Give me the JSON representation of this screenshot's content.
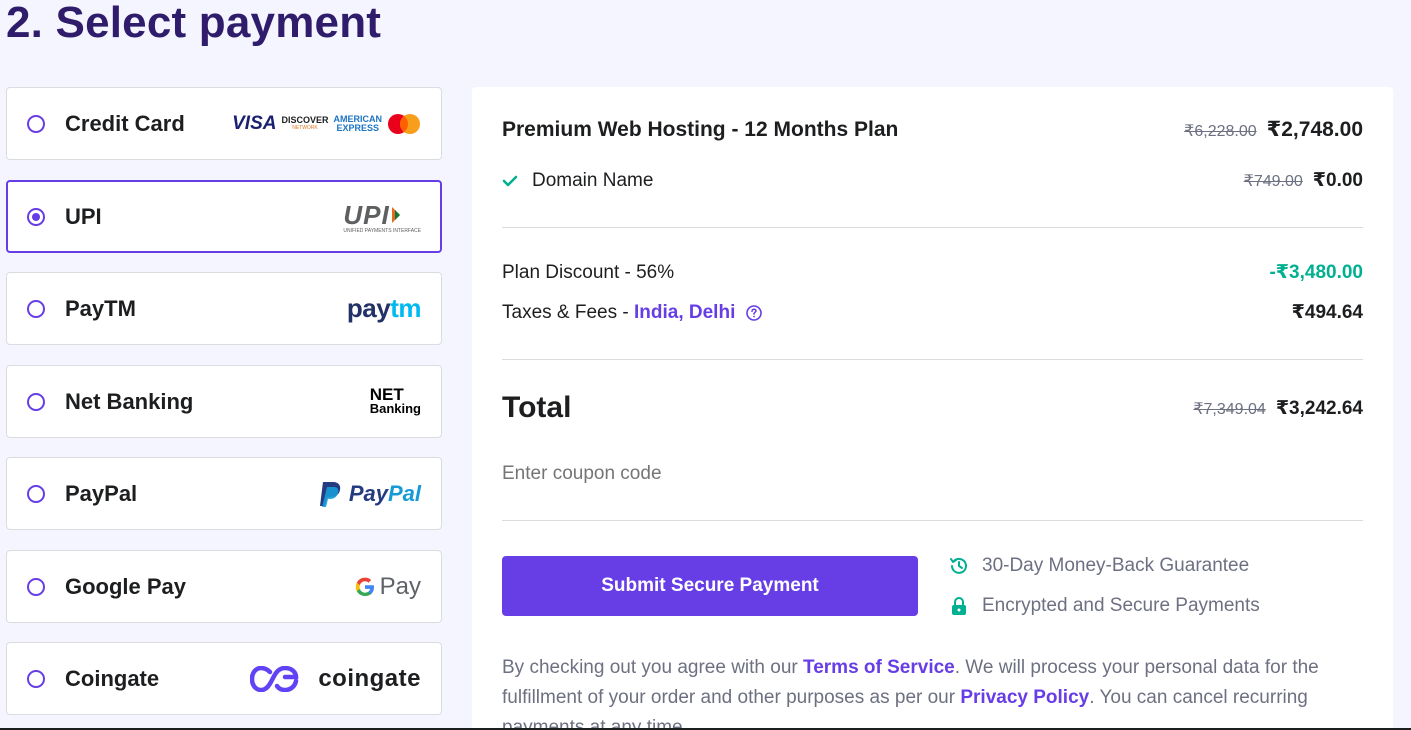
{
  "page": {
    "title": "2. Select payment"
  },
  "methods": [
    {
      "label": "Credit Card",
      "selected": false,
      "logo": "card-brands-logo"
    },
    {
      "label": "UPI",
      "selected": true,
      "logo": "upi-logo"
    },
    {
      "label": "PayTM",
      "selected": false,
      "logo": "paytm-logo"
    },
    {
      "label": "Net Banking",
      "selected": false,
      "logo": "net-banking-logo"
    },
    {
      "label": "PayPal",
      "selected": false,
      "logo": "paypal-logo"
    },
    {
      "label": "Google Pay",
      "selected": false,
      "logo": "google-pay-logo"
    },
    {
      "label": "Coingate",
      "selected": false,
      "logo": "coingate-logo"
    }
  ],
  "logos": {
    "visa": "VISA",
    "discover": "DISCOVER",
    "discover_sub": "NETWORK",
    "amex_1": "AMERICAN",
    "amex_2": "EXPRESS",
    "upi": "UPI",
    "upi_sub": "UNIFIED PAYMENTS INTERFACE",
    "paytm_1": "pay",
    "paytm_2": "tm",
    "net_1": "NET",
    "net_2": "Banking",
    "paypal_1": "Pay",
    "paypal_2": "Pal",
    "gpay": "Pay",
    "coingate": "coingate"
  },
  "summary": {
    "plan_name": "Premium Web Hosting - 12 Months Plan",
    "plan_old_price": "₹6,228.00",
    "plan_price": "₹2,748.00",
    "domain_label": "Domain Name",
    "domain_old_price": "₹749.00",
    "domain_price": "₹0.00",
    "discount_label": "Plan Discount - 56%",
    "discount_value": "-₹3,480.00",
    "taxes_label": "Taxes & Fees - ",
    "taxes_location": "India, Delhi",
    "taxes_value": "₹494.64",
    "total_label": "Total",
    "total_old": "₹7,349.04",
    "total_value": "₹3,242.64",
    "coupon_placeholder": "Enter coupon code",
    "submit_label": "Submit Secure Payment",
    "guarantee_1": "30-Day Money-Back Guarantee",
    "guarantee_2": "Encrypted and Secure Payments",
    "legal_1": "By checking out you agree with our ",
    "terms_link": "Terms of Service",
    "legal_2": ". We will process your personal data for the fulfillment of your order and other purposes as per our ",
    "privacy_link": "Privacy Policy",
    "legal_3": ". You can cancel recurring payments at any time."
  },
  "colors": {
    "accent": "#673de6",
    "heading": "#2f1c6a",
    "success": "#00b090",
    "background": "#f4f5ff"
  }
}
